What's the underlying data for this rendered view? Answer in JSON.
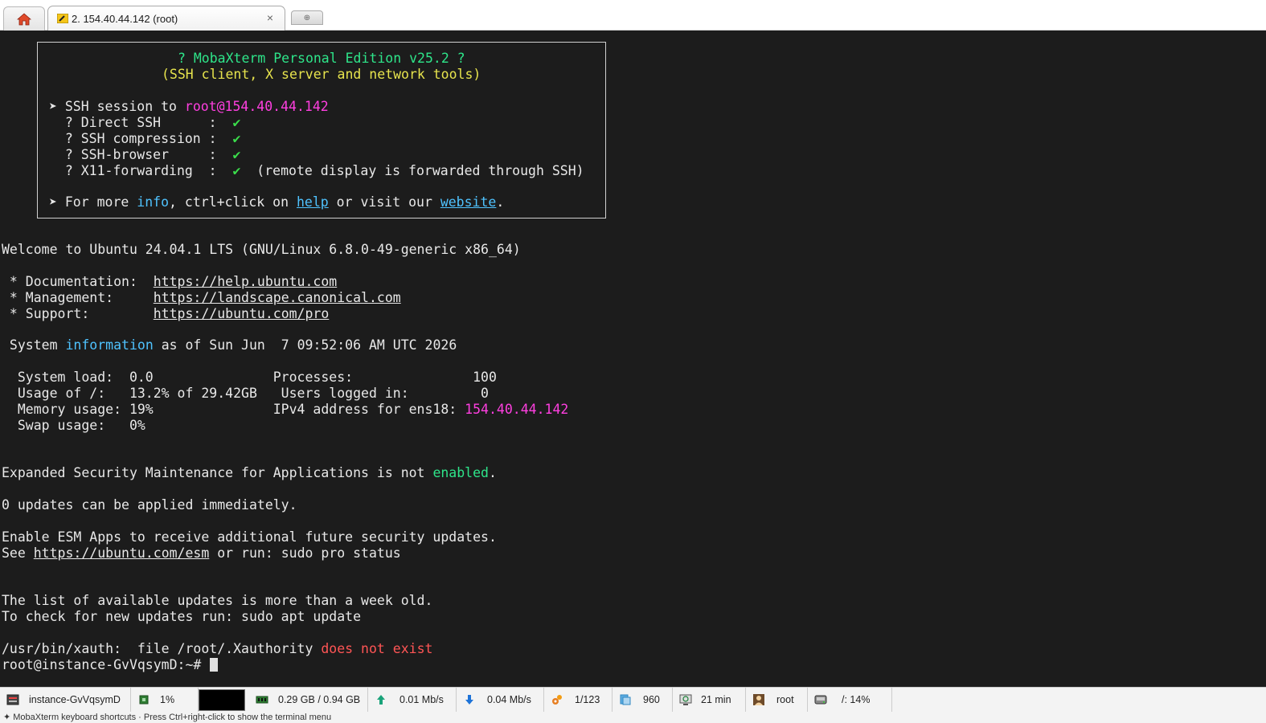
{
  "tabs": {
    "home_icon": "home-icon",
    "session_label": "2. 154.40.44.142 (root)",
    "close_glyph": "×",
    "new_tab_glyph": "⊕"
  },
  "banner": {
    "title": "? MobaXterm Personal Edition v25.2 ?",
    "subtitle": "(SSH client, X server and network tools)",
    "ssh_prefix": "➤ SSH session to ",
    "ssh_host": "root@154.40.44.142",
    "features": [
      {
        "label": "  ? Direct SSH      :  ",
        "mark": "✔",
        "note": ""
      },
      {
        "label": "  ? SSH compression :  ",
        "mark": "✔",
        "note": ""
      },
      {
        "label": "  ? SSH-browser     :  ",
        "mark": "✔",
        "note": ""
      },
      {
        "label": "  ? X11-forwarding  :  ",
        "mark": "✔",
        "note": "  (remote display is forwarded through SSH)"
      }
    ],
    "more_prefix": "➤ For more ",
    "more_info": "info",
    "more_mid": ", ctrl+click on ",
    "more_help": "help",
    "more_mid2": " or visit our ",
    "more_website": "website",
    "more_end": "."
  },
  "motd": {
    "welcome": "Welcome to Ubuntu 24.04.1 LTS (GNU/Linux 6.8.0-49-generic x86_64)",
    "doc_label": " * Documentation:  ",
    "doc_url": "https://help.ubuntu.com",
    "mgmt_label": " * Management:     ",
    "mgmt_url": "https://landscape.canonical.com",
    "support_label": " * Support:        ",
    "support_url": "https://ubuntu.com/pro",
    "sysinfo_prefix": " System ",
    "sysinfo_word": "information",
    "sysinfo_suffix": " as of Sun Jun  7 09:52:06 AM UTC 2026",
    "stats_line1": "  System load:  0.0               Processes:               100",
    "stats_line2": "  Usage of /:   13.2% of 29.42GB   Users logged in:         0",
    "stats_line3_prefix": "  Memory usage: 19%               IPv4 address for ens18: ",
    "stats_ip": "154.40.44.142",
    "stats_line4": "  Swap usage:   0%",
    "esm_prefix": "Expanded Security Maintenance for Applications is not ",
    "esm_word": "enabled",
    "esm_end": ".",
    "updates": "0 updates can be applied immediately.",
    "enable_esm": "Enable ESM Apps to receive additional future security updates.",
    "see_prefix": "See ",
    "see_url": "https://ubuntu.com/esm",
    "see_suffix": " or run: sudo pro status",
    "list_old": "The list of available updates is more than a week old.",
    "check_new": "To check for new updates run: sudo apt update",
    "xauth_prefix": "/usr/bin/xauth:  file /root/.Xauthority ",
    "xauth_err": "does not exist",
    "prompt": "root@instance-GvVqsymD:~# "
  },
  "status": {
    "hostname": "instance-GvVqsymD",
    "cpu": "1%",
    "memory": "0.29 GB / 0.94 GB",
    "upload": "0.01 Mb/s",
    "download": "0.04 Mb/s",
    "sessions": "1/123",
    "processes": "960",
    "uptime": "21 min",
    "user": "root",
    "disk": "/: 14%"
  },
  "bottom_text": "✦ MobaXterm  keyboard shortcuts   ·   Press Ctrl+right-click to show the terminal menu",
  "colors": {
    "terminal_bg": "#1c1c1c",
    "green": "#2ee58a",
    "yellow": "#e7e44d",
    "magenta": "#ff3fe0",
    "cyan": "#4fc3ff",
    "red": "#ff5555"
  }
}
